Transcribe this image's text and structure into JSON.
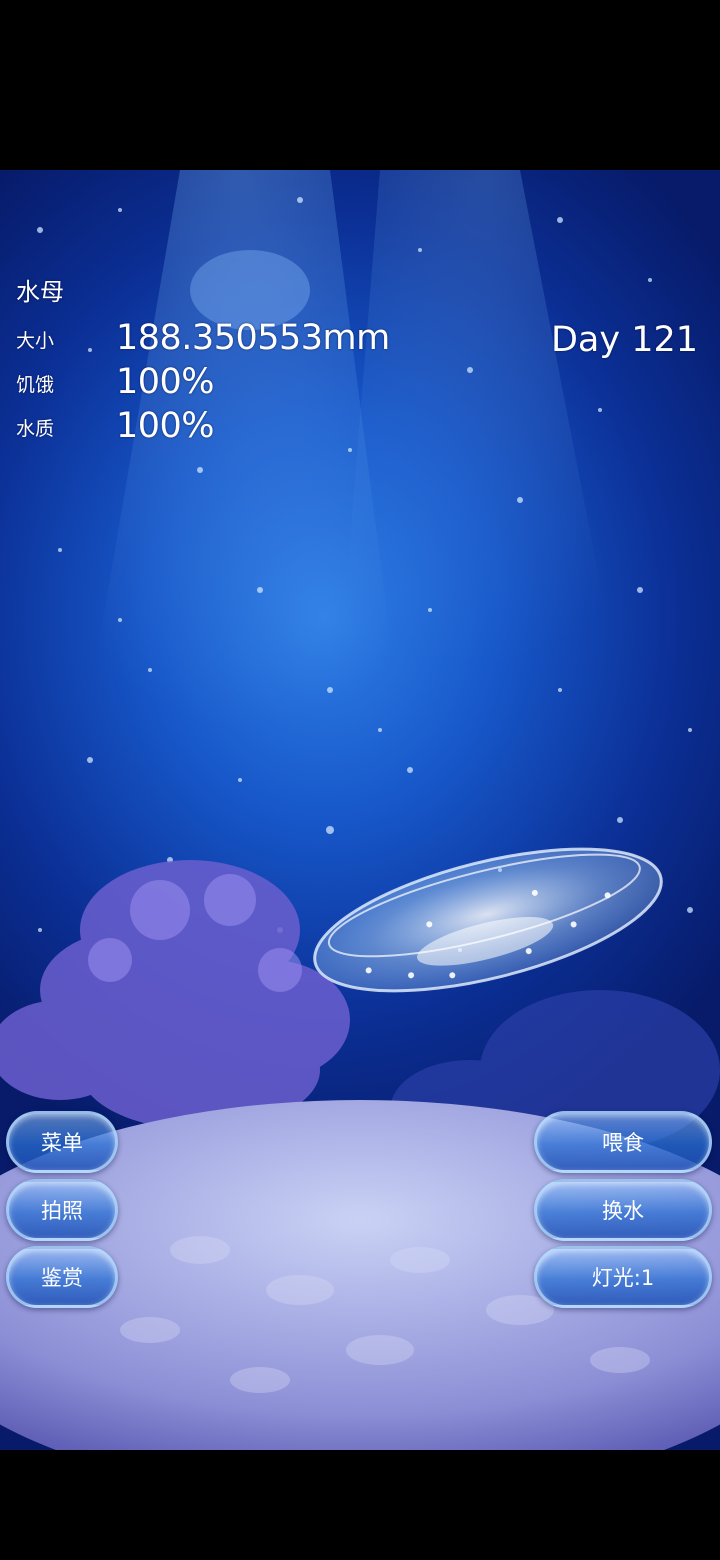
{
  "hud": {
    "title": "水母",
    "size_label": "大小",
    "size_value": "188.350553mm",
    "hunger_label": "饥饿",
    "hunger_value": "100%",
    "water_label": "水质",
    "water_value": "100%",
    "day": "Day 121"
  },
  "buttons": {
    "menu": "菜单",
    "photo": "拍照",
    "appreciate": "鉴赏",
    "feed": "喂食",
    "change_water": "换水",
    "light": "灯光:1"
  },
  "colors": {
    "deep_water": "#0b2f95",
    "light_water": "#2f7fe6",
    "coral": "#6b5fcf",
    "sand": "#a9b3e6"
  }
}
